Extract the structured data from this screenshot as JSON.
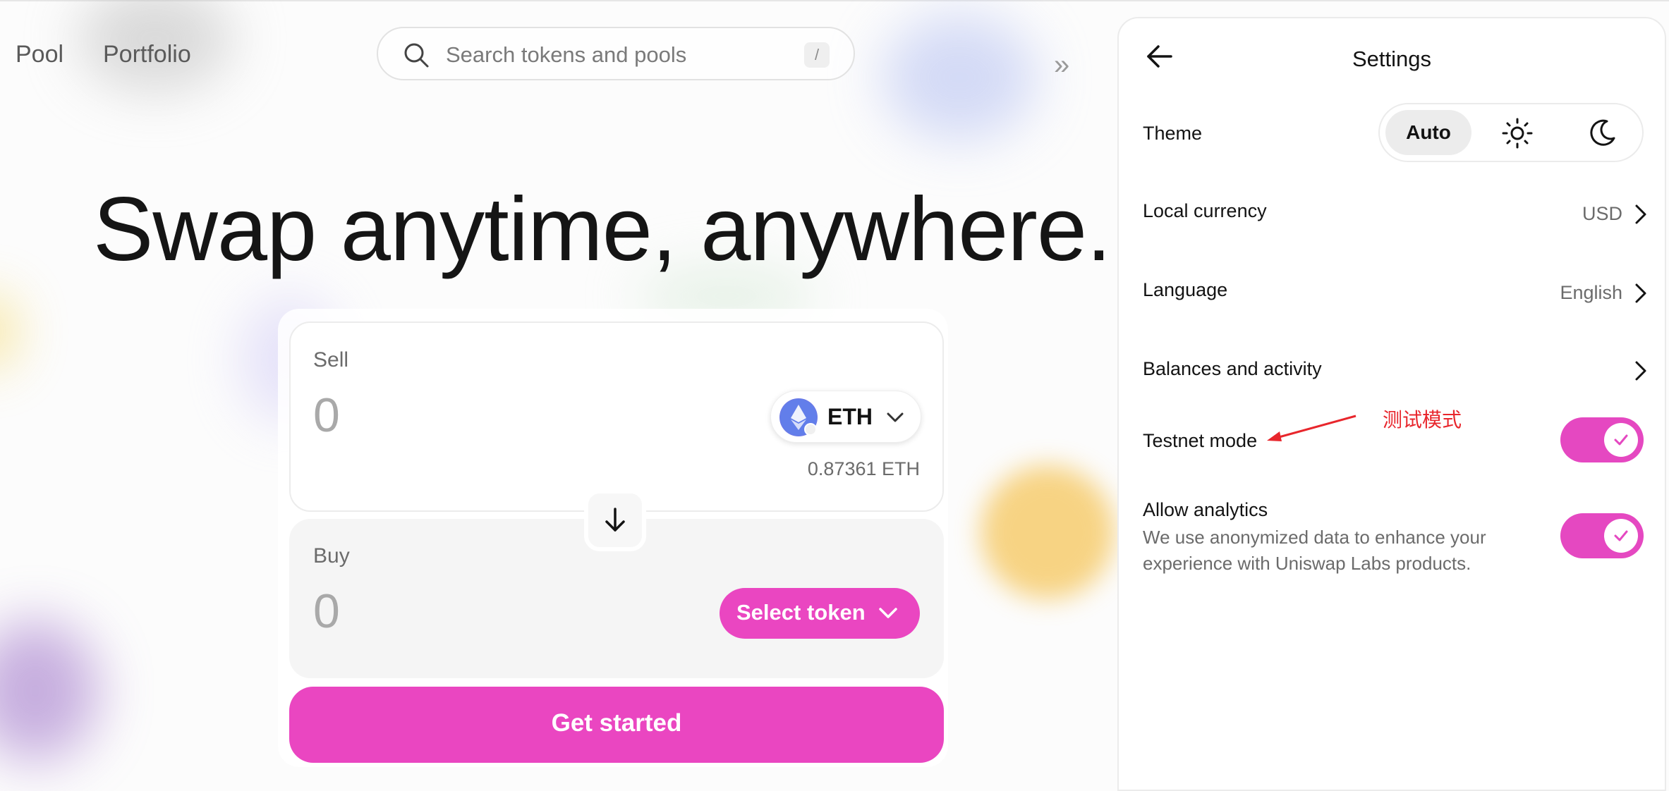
{
  "nav": {
    "pool": "Pool",
    "portfolio": "Portfolio"
  },
  "search": {
    "placeholder": "Search tokens and pools",
    "shortcut": "/"
  },
  "expand_glyph": "»",
  "hero": {
    "headline": "Swap anytime, anywhere."
  },
  "swap": {
    "sell": {
      "label": "Sell",
      "amount": "0",
      "token": "ETH",
      "balance": "0.87361 ETH"
    },
    "buy": {
      "label": "Buy",
      "amount": "0",
      "select_label": "Select token"
    },
    "cta": "Get started"
  },
  "settings": {
    "title": "Settings",
    "theme": {
      "label": "Theme",
      "options": [
        "Auto",
        "light",
        "dark"
      ],
      "selected": "Auto"
    },
    "local_currency": {
      "label": "Local currency",
      "value": "USD"
    },
    "language": {
      "label": "Language",
      "value": "English"
    },
    "balances": {
      "label": "Balances and activity"
    },
    "testnet": {
      "label": "Testnet mode",
      "enabled": true
    },
    "analytics": {
      "label": "Allow analytics",
      "description": "We use anonymized data to enhance your experience with Uniswap Labs products.",
      "enabled": true
    }
  },
  "annotation": {
    "text": "测试模式",
    "color": "#e8262c"
  },
  "colors": {
    "accent": "#ea46c1",
    "toggle": "#e548c1"
  },
  "icons": [
    "search-icon",
    "double-chevron-right-icon",
    "eth-token-icon",
    "chevron-down-icon",
    "arrow-down-icon",
    "arrow-left-icon",
    "sun-icon",
    "moon-icon",
    "chevron-right-icon",
    "check-icon"
  ]
}
